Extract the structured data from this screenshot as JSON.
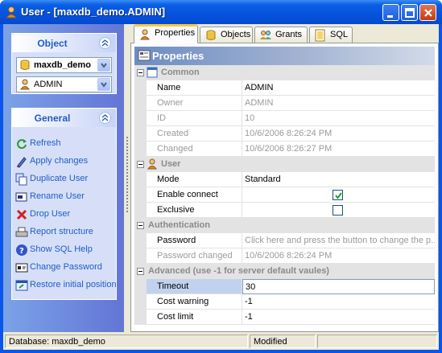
{
  "window": {
    "title": "User - [maxdb_demo.ADMIN]",
    "accent": "#0a55ea"
  },
  "sidebar": {
    "object_group": {
      "title": "Object",
      "database_combo": "maxdb_demo",
      "user_combo": "ADMIN"
    },
    "general_group": {
      "title": "General",
      "items": [
        {
          "label": "Refresh",
          "icon": "refresh-icon"
        },
        {
          "label": "Apply changes",
          "icon": "apply-changes-icon"
        },
        {
          "label": "Duplicate User",
          "icon": "duplicate-user-icon"
        },
        {
          "label": "Rename User",
          "icon": "rename-user-icon"
        },
        {
          "label": "Drop User",
          "icon": "drop-user-icon"
        },
        {
          "label": "Report structure",
          "icon": "report-structure-icon"
        },
        {
          "label": "Show SQL Help",
          "icon": "help-icon"
        },
        {
          "label": "Change Password",
          "icon": "change-password-icon"
        },
        {
          "label": "Restore initial position",
          "icon": "restore-position-icon"
        }
      ]
    }
  },
  "tabs": [
    {
      "label": "Properties",
      "active": true
    },
    {
      "label": "Objects",
      "active": false
    },
    {
      "label": "Grants",
      "active": false
    },
    {
      "label": "SQL",
      "active": false
    }
  ],
  "panel": {
    "title": "Properties",
    "categories": {
      "common": "Common",
      "user": "User",
      "authentication": "Authentication",
      "advanced": "Advanced (use -1 for server default vaules)"
    },
    "common_rows": [
      {
        "name": "Name",
        "value": "ADMIN"
      },
      {
        "name": "Owner",
        "value": "ADMIN"
      },
      {
        "name": "ID",
        "value": "10"
      },
      {
        "name": "Created",
        "value": "10/6/2006 8:26:24 PM"
      },
      {
        "name": "Changed",
        "value": "10/6/2006 8:26:27 PM"
      }
    ],
    "user_rows": [
      {
        "name": "Mode",
        "value": "Standard"
      },
      {
        "name": "Enable connect",
        "checked": true
      },
      {
        "name": "Exclusive",
        "checked": false
      }
    ],
    "auth_rows": [
      {
        "name": "Password",
        "value": "Click here and press the button to change the p..."
      },
      {
        "name": "Password changed",
        "value": "10/6/2006 8:26:24 PM"
      }
    ],
    "advanced_rows": [
      {
        "name": "Timeout",
        "value": "30"
      },
      {
        "name": "Cost warning",
        "value": "-1"
      },
      {
        "name": "Cost limit",
        "value": "-1"
      }
    ]
  },
  "status": {
    "database": "Database: maxdb_demo",
    "state": "Modified"
  }
}
